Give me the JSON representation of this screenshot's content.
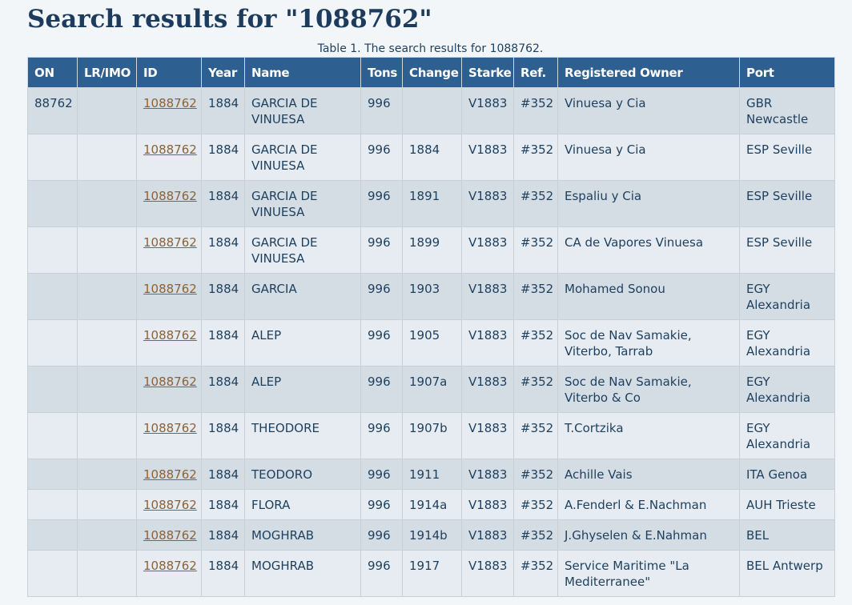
{
  "page": {
    "title": "Search results for \"1088762\"",
    "caption": "Table 1. The search results for 1088762."
  },
  "table": {
    "headers": [
      "ON",
      "LR/IMO",
      "ID",
      "Year",
      "Name",
      "Tons",
      "Change",
      "Starke",
      "Ref.",
      "Registered Owner",
      "Port"
    ],
    "rows": [
      [
        "88762",
        "",
        "1088762",
        "1884",
        "GARCIA DE VINUESA",
        "996",
        "",
        "V1883",
        "#352",
        "Vinuesa y Cia",
        "GBR Newcastle"
      ],
      [
        "",
        "",
        "1088762",
        "1884",
        "GARCIA DE VINUESA",
        "996",
        "1884",
        "V1883",
        "#352",
        "Vinuesa y Cia",
        "ESP Seville"
      ],
      [
        "",
        "",
        "1088762",
        "1884",
        "GARCIA DE VINUESA",
        "996",
        "1891",
        "V1883",
        "#352",
        "Espaliu y Cia",
        "ESP Seville"
      ],
      [
        "",
        "",
        "1088762",
        "1884",
        "GARCIA DE VINUESA",
        "996",
        "1899",
        "V1883",
        "#352",
        "CA de Vapores Vinuesa",
        "ESP Seville"
      ],
      [
        "",
        "",
        "1088762",
        "1884",
        "GARCIA",
        "996",
        "1903",
        "V1883",
        "#352",
        "Mohamed Sonou",
        "EGY Alexandria"
      ],
      [
        "",
        "",
        "1088762",
        "1884",
        "ALEP",
        "996",
        "1905",
        "V1883",
        "#352",
        "Soc de Nav Samakie, Viterbo, Tarrab",
        "EGY Alexandria"
      ],
      [
        "",
        "",
        "1088762",
        "1884",
        "ALEP",
        "996",
        "1907a",
        "V1883",
        "#352",
        "Soc de Nav Samakie, Viterbo & Co",
        "EGY Alexandria"
      ],
      [
        "",
        "",
        "1088762",
        "1884",
        "THEODORE",
        "996",
        "1907b",
        "V1883",
        "#352",
        "T.Cortzika",
        "EGY Alexandria"
      ],
      [
        "",
        "",
        "1088762",
        "1884",
        "TEODORO",
        "996",
        "1911",
        "V1883",
        "#352",
        "Achille Vais",
        "ITA Genoa"
      ],
      [
        "",
        "",
        "1088762",
        "1884",
        "FLORA",
        "996",
        "1914a",
        "V1883",
        "#352",
        "A.Fenderl & E.Nachman",
        "AUH Trieste"
      ],
      [
        "",
        "",
        "1088762",
        "1884",
        "MOGHRAB",
        "996",
        "1914b",
        "V1883",
        "#352",
        "J.Ghyselen & E.Nahman",
        "BEL"
      ],
      [
        "",
        "",
        "1088762",
        "1884",
        "MOGHRAB",
        "996",
        "1917",
        "V1883",
        "#352",
        "Service Maritime \"La Mediterranee\"",
        "BEL Antwerp"
      ]
    ]
  },
  "colors": {
    "header_bg": "#2d5f91",
    "row_odd": "#d5dde4",
    "row_even": "#e6ecf1",
    "link": "#8a6238",
    "title": "#1c3b5d"
  }
}
